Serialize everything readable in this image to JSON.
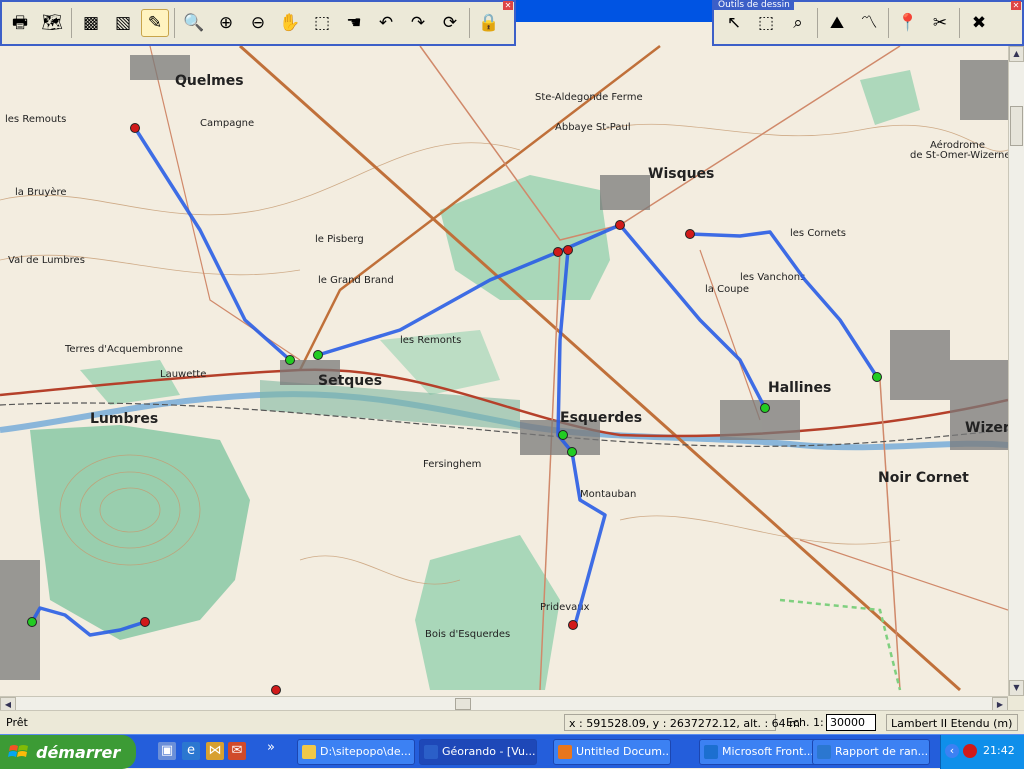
{
  "toolbars": {
    "main_tools": [
      {
        "name": "print-icon",
        "glyph": "🖶"
      },
      {
        "name": "open-map-icon",
        "glyph": "🗺"
      },
      {
        "name": "layer-gray-icon",
        "glyph": "▩"
      },
      {
        "name": "layer-silhouette-icon",
        "glyph": "▧"
      },
      {
        "name": "pencil-icon",
        "glyph": "✎"
      },
      {
        "name": "zoom-globe-icon",
        "glyph": "🔍"
      },
      {
        "name": "zoom-in-icon",
        "glyph": "⊕"
      },
      {
        "name": "zoom-out-icon",
        "glyph": "⊖"
      },
      {
        "name": "zoom-hand-icon",
        "glyph": "✋"
      },
      {
        "name": "zoom-window-icon",
        "glyph": "⬚"
      },
      {
        "name": "pan-hand-icon",
        "glyph": "☚"
      },
      {
        "name": "undo-icon",
        "glyph": "↶"
      },
      {
        "name": "redo-icon",
        "glyph": "↷"
      },
      {
        "name": "refresh-icon",
        "glyph": "⟳"
      },
      {
        "name": "lock-icon",
        "glyph": "🔒"
      }
    ],
    "drawing": {
      "title": "Outils de dessin",
      "tools": [
        {
          "name": "select-arrow-icon",
          "glyph": "↖"
        },
        {
          "name": "select-rectangle-icon",
          "glyph": "⬚"
        },
        {
          "name": "select-zoom-icon",
          "glyph": "⌕"
        },
        {
          "name": "elevation-profile-icon",
          "glyph": "⛰"
        },
        {
          "name": "draw-route-icon",
          "glyph": "〽"
        },
        {
          "name": "waypoint-pins-icon",
          "glyph": "📍"
        },
        {
          "name": "cut-route-icon",
          "glyph": "✂"
        },
        {
          "name": "delete-icon",
          "glyph": "✖"
        }
      ]
    }
  },
  "map": {
    "labels": [
      "Quelmes",
      "les Remouts",
      "Campagne",
      "Setques",
      "Lumbres",
      "Esquerdes",
      "Hallines",
      "Wizern",
      "Wisques",
      "Aérodrome",
      "de St-Omer-Wizernes",
      "Noir Cornet",
      "Fersinghem",
      "Bois d'Esquerdes",
      "Lauwette",
      "le Pisberg",
      "les Cornets",
      "Abbaye St-Paul",
      "Ste-Aldegonde Ferme",
      "Val de Lumbres",
      "Montauban",
      "Pridevaux",
      "Terres d'Acquembronne",
      "les Vanchons",
      "le Grand Brand",
      "la Coupe",
      "les Remonts",
      "la Bruyère"
    ],
    "legend_colors": {
      "route": "#2a5ee6",
      "waypoint_start": "#d11a1a",
      "waypoint_mid": "#22cc22",
      "forest": "#9bd2b1"
    }
  },
  "status": {
    "ready": "Prêt",
    "coords": "x : 591528.09, y : 2637272.12, alt. : 64 m",
    "scale_label": "Ech. 1:",
    "scale_value": "30000",
    "projection": "Lambert II Etendu (m)"
  },
  "taskbar": {
    "start_label": "démarrer",
    "quick_launch": [
      "desktop-icon",
      "ie-icon",
      "media-icon",
      "mail-icon"
    ],
    "more": "»",
    "tasks": [
      {
        "label": "D:\\sitepopo\\de...",
        "icon": "folder-icon"
      },
      {
        "label": "Géorando - [Vu...",
        "icon": "georando-icon",
        "active": true
      },
      {
        "label": "Untitled Docum...",
        "icon": "firefox-icon"
      },
      {
        "label": "Microsoft Front...",
        "icon": "frontpage-icon"
      },
      {
        "label": "Rapport de ran...",
        "icon": "ie-icon"
      }
    ],
    "tray_arrow": "‹",
    "clock": "21:42"
  }
}
